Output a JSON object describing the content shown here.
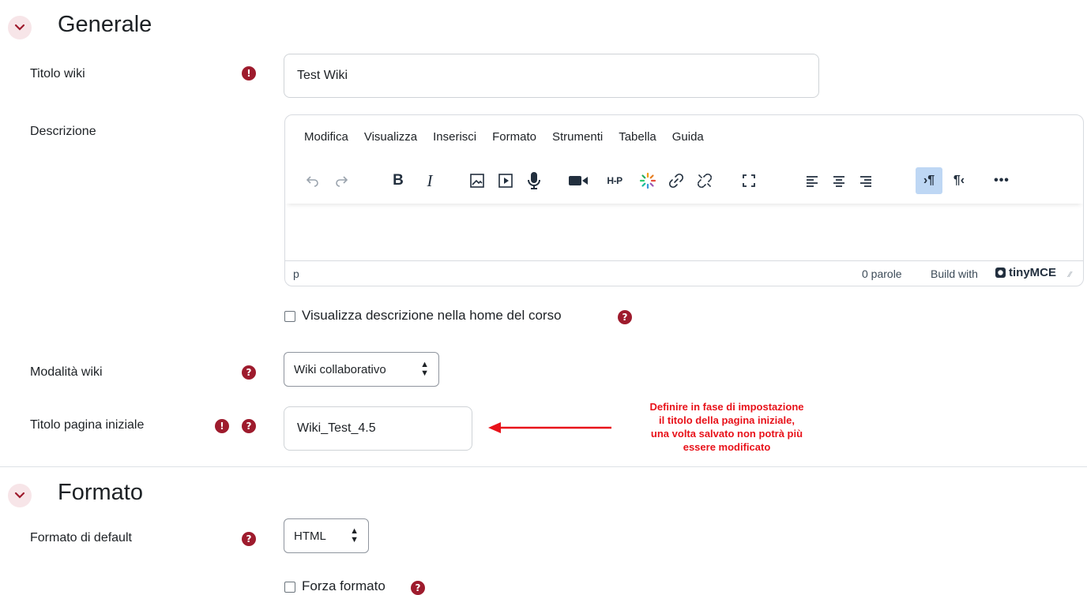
{
  "sections": {
    "general": {
      "title": "Generale"
    },
    "format": {
      "title": "Formato"
    }
  },
  "fields": {
    "wiki_title": {
      "label": "Titolo wiki",
      "value": "Test Wiki"
    },
    "description": {
      "label": "Descrizione"
    },
    "show_description": {
      "label": "Visualizza descrizione nella home del corso"
    },
    "wiki_mode": {
      "label": "Modalità wiki",
      "selected": "Wiki collaborativo"
    },
    "first_page_title": {
      "label": "Titolo pagina iniziale",
      "value": "Wiki_Test_4.5"
    },
    "default_format": {
      "label": "Formato di default",
      "selected": "HTML"
    },
    "force_format": {
      "label": "Forza formato"
    }
  },
  "editor": {
    "menus": [
      "Modifica",
      "Visualizza",
      "Inserisci",
      "Formato",
      "Strumenti",
      "Tabella",
      "Guida"
    ],
    "status_path": "p",
    "word_count": "0 parole",
    "branding_prefix": "Build with",
    "branding_name": "tinyMCE",
    "toolbar_icons": [
      "undo-icon",
      "redo-icon",
      "bold-icon",
      "italic-icon",
      "image-icon",
      "media-icon",
      "microphone-icon",
      "video-camera-icon",
      "h5p-icon",
      "loading-spinner-icon",
      "link-icon",
      "unlink-icon",
      "fullscreen-icon",
      "align-left-icon",
      "align-center-icon",
      "align-right-icon",
      "ltr-icon",
      "rtl-icon",
      "more-icon"
    ]
  },
  "annotation": {
    "lines": [
      "Definire in fase di impostazione",
      "il titolo della pagina iniziale,",
      "una volta salvato non potrà più",
      "essere modificato"
    ],
    "color": "#e8121a"
  },
  "colors": {
    "accent": "#9e1b2d",
    "toggle_bg": "#f7e5e8",
    "active_btn": "#bed7f4"
  }
}
